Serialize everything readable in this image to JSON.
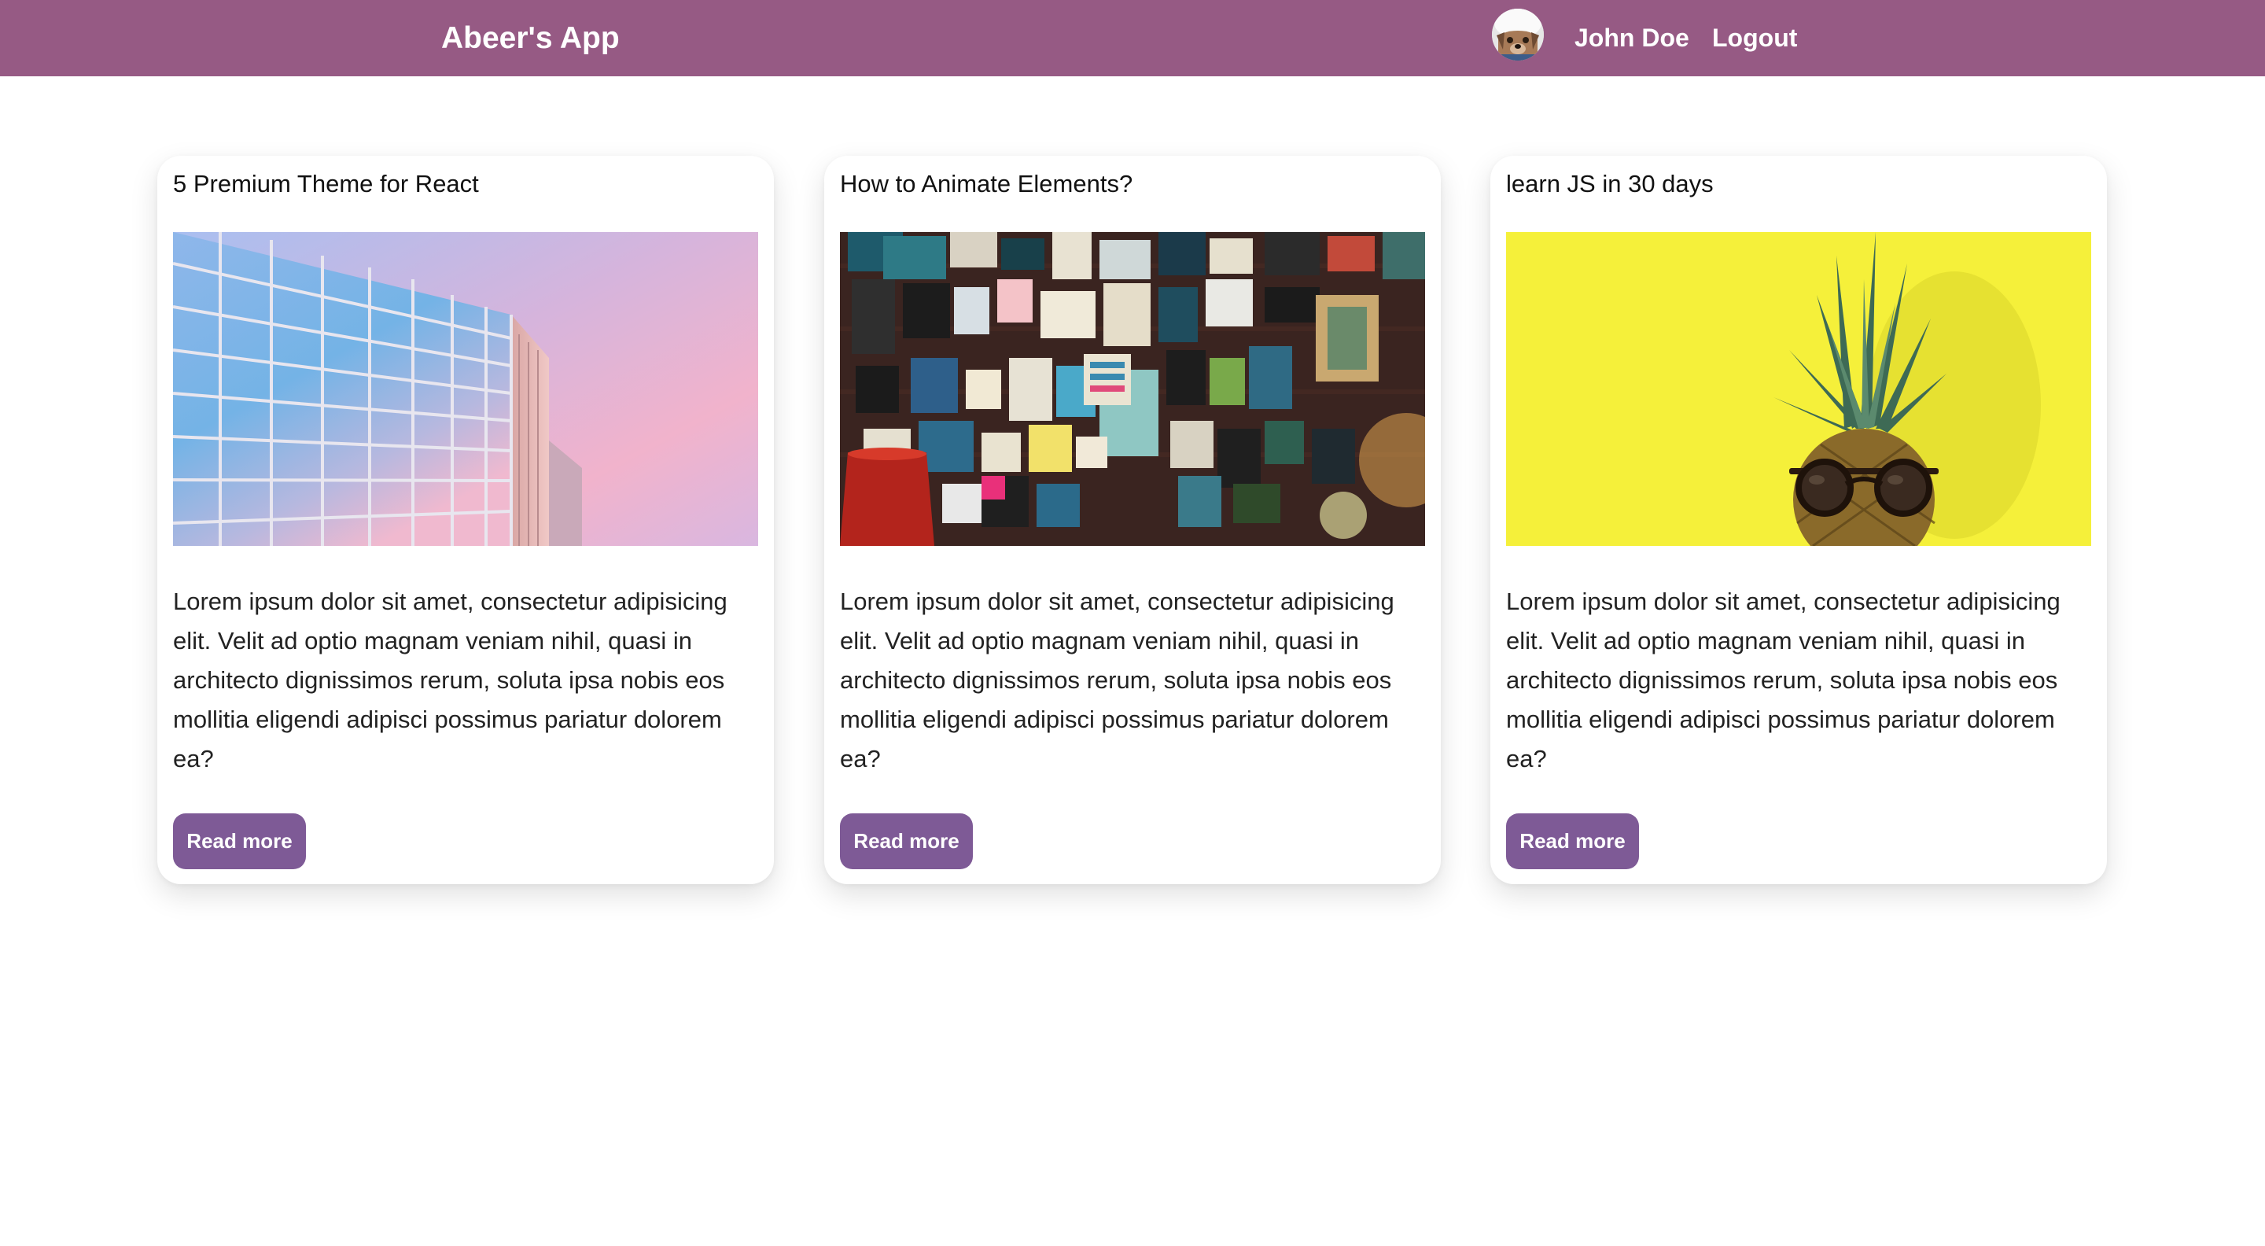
{
  "header": {
    "brand": "Abeer's App",
    "user_name": "John Doe",
    "logout_label": "Logout",
    "background_color": "#965a84"
  },
  "cards": [
    {
      "title": "5 Premium Theme for React",
      "image": "glass-building-pastel-sky",
      "body": "Lorem ipsum dolor sit amet, consectetur adipisicing elit. Velit ad optio magnam veniam nihil, quasi in architecto dignissimos rerum, soluta ipsa nobis eos mollitia eligendi adipisci possimus pariatur dolorem ea?",
      "button_label": "Read more"
    },
    {
      "title": "How to Animate Elements?",
      "image": "wall-of-signs-and-posters",
      "body": "Lorem ipsum dolor sit amet, consectetur adipisicing elit. Velit ad optio magnam veniam nihil, quasi in architecto dignissimos rerum, soluta ipsa nobis eos mollitia eligendi adipisci possimus pariatur dolorem ea?",
      "button_label": "Read more"
    },
    {
      "title": "learn JS in 30 days",
      "image": "pineapple-with-sunglasses-yellow",
      "body": "Lorem ipsum dolor sit amet, consectetur adipisicing elit. Velit ad optio magnam veniam nihil, quasi in architecto dignissimos rerum, soluta ipsa nobis eos mollitia eligendi adipisci possimus pariatur dolorem ea?",
      "button_label": "Read more"
    }
  ],
  "colors": {
    "button": "#7e5a96",
    "card_background": "#ffffff"
  }
}
